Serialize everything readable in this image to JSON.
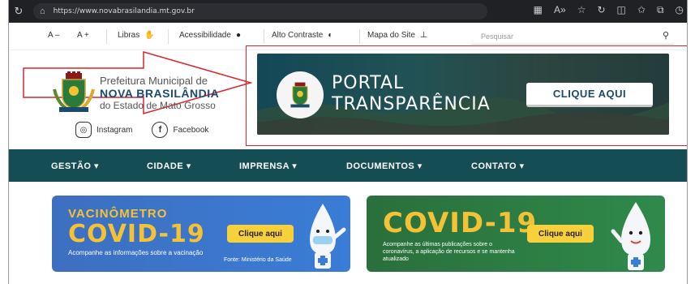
{
  "browser": {
    "url": "https://www.novabrasilandia.mt.gov.br",
    "icons": [
      "refresh-icon",
      "lock-icon",
      "grid-icon",
      "read-aloud-icon",
      "favorite-star-icon",
      "extension-icon",
      "split-view-icon",
      "favorites-icon",
      "collections-icon",
      "history-icon"
    ]
  },
  "accessibility": {
    "font_decrease": "A –",
    "font_increase": "A +",
    "libras": "Libras",
    "acessibilidade": "Acessibilidade",
    "alto_contraste": "Alto Contraste",
    "mapa_site": "Mapa do Site",
    "search_placeholder": "Pesquisar"
  },
  "header": {
    "line1": "Prefeitura Municipal de",
    "line2": "NOVA BRASILÂNDIA",
    "line3": "do Estado de Mato Grosso",
    "instagram": "Instagram",
    "facebook": "Facebook"
  },
  "banner": {
    "title1": "PORTAL",
    "title2": "TRANSPARÊNCIA",
    "button": "CLIQUE AQUI"
  },
  "nav": {
    "items": [
      "GESTÃO ▾",
      "CIDADE ▾",
      "IMPRENSA ▾",
      "DOCUMENTOS ▾",
      "CONTATO ▾"
    ]
  },
  "cards": {
    "vacinometro": {
      "title1": "VACINÔMETRO",
      "title2": "COVID-19",
      "desc": "Acompanhe as informações sobre a vacinação",
      "cta": "Clique aqui",
      "source": "Fonte: Ministério da Saúde"
    },
    "covid": {
      "title": "COVID-19",
      "desc": "Acompanhe as últimas publicações sobre o coronavírus, a aplicação de recursos e se mantenha atualizado",
      "cta": "Clique aqui"
    }
  },
  "colors": {
    "nav_bg": "#154d55",
    "highlight_red": "#d9262c",
    "card_blue": "#3a7dd6",
    "card_green": "#2f8a4a",
    "cta_yellow": "#f7d03a",
    "title_yellow": "#f4c234"
  }
}
